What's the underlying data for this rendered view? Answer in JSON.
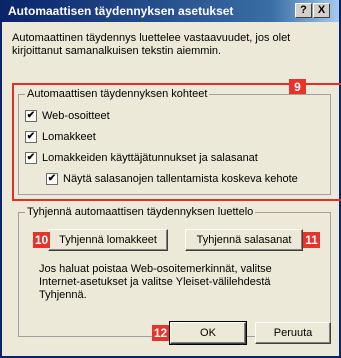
{
  "window": {
    "title": "Automaattisen täydennyksen asetukset",
    "help_label": "?",
    "close_label": "X"
  },
  "description": [
    "Automaattinen täydennys luettelee vastaavuudet, jos olet",
    "kirjoittanut samanalkuisen tekstin aiemmin."
  ],
  "targets_group": {
    "legend": "Automaattisen täydennyksen kohteet",
    "badge": "9",
    "items": [
      {
        "label": "Web-osoitteet",
        "checked": true
      },
      {
        "label": "Lomakkeet",
        "checked": true
      },
      {
        "label": "Lomakkeiden käyttäjätunnukset ja salasanat",
        "checked": true
      },
      {
        "label": "Näytä salasanojen tallentamista koskeva kehote",
        "checked": true
      }
    ]
  },
  "clear_group": {
    "legend": "Tyhjennä automaattisen täydennyksen luettelo",
    "clear_forms_label": "Tyhjennä lomakkeet",
    "clear_forms_badge": "10",
    "clear_passwords_label": "Tyhjennä salasanat",
    "clear_passwords_badge": "11",
    "info_lines": [
      "Jos haluat poistaa Web-osoitemerkinnät, valitse",
      "Internet-asetukset ja valitse Yleiset-välilehdestä",
      "Tyhjennä."
    ]
  },
  "footer": {
    "ok_label": "OK",
    "ok_badge": "12",
    "cancel_label": "Peruuta"
  },
  "check_mark": "✔"
}
